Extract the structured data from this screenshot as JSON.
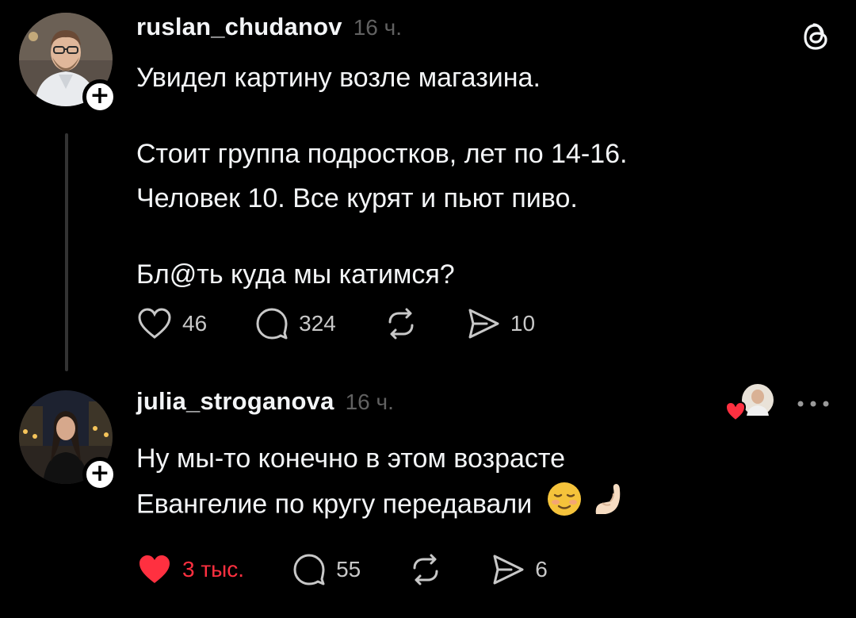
{
  "app": {
    "logo_icon": "threads-logo-icon"
  },
  "posts": [
    {
      "username": "ruslan_chudanov",
      "timestamp": "16 ч.",
      "paragraphs": [
        "Увидел картину возле магазина.",
        "Стоит группа подростков, лет по 14-16.",
        "Человек 10. Все курят и пьют пиво.",
        "Бл@ть куда мы катимся?"
      ],
      "likes": "46",
      "replies": "324",
      "reposts": "",
      "shares": "10",
      "liked": false
    },
    {
      "username": "julia_stroganova",
      "timestamp": "16 ч.",
      "paragraphs": [
        "Ну мы-то конечно в этом возрасте",
        "Евангелие по кругу передавали"
      ],
      "likes": "3 тыс.",
      "replies": "55",
      "reposts": "",
      "shares": "6",
      "liked": true,
      "liked_by_author_icon": "author-liked-heart-avatar-icon",
      "emoji": [
        "relieved-face-emoji",
        "pinching-hand-emoji"
      ]
    }
  ],
  "colors": {
    "background": "#000000",
    "text": "#f3f5f7",
    "muted": "#616161",
    "like_red": "#ff3040",
    "thread_line": "#333333"
  }
}
